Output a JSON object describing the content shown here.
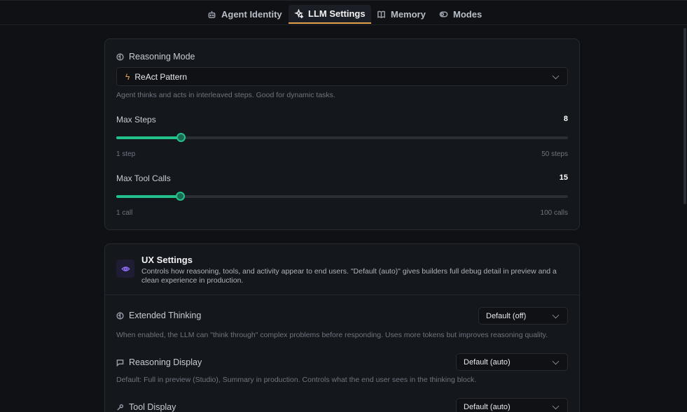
{
  "tabs": [
    {
      "label": "Agent Identity",
      "icon": "robot-icon",
      "active": false
    },
    {
      "label": "LLM Settings",
      "icon": "sparkles-icon",
      "active": true
    },
    {
      "label": "Memory",
      "icon": "book-icon",
      "active": false
    },
    {
      "label": "Modes",
      "icon": "toggle-icon",
      "active": false
    }
  ],
  "reasoning": {
    "label": "Reasoning Mode",
    "selected": "ReAct Pattern",
    "helper": "Agent thinks and acts in interleaved steps. Good for dynamic tasks."
  },
  "max_steps": {
    "label": "Max Steps",
    "value": "8",
    "min_label": "1 step",
    "max_label": "50 steps",
    "fraction": 0.1429
  },
  "max_tool_calls": {
    "label": "Max Tool Calls",
    "value": "15",
    "min_label": "1 call",
    "max_label": "100 calls",
    "fraction": 0.1414
  },
  "ux": {
    "title": "UX Settings",
    "description": "Controls how reasoning, tools, and activity appear to end users. \"Default (auto)\" gives builders full debug detail in preview and a clean experience in production.",
    "extended_thinking": {
      "label": "Extended Thinking",
      "selected": "Default (off)",
      "helper": "When enabled, the LLM can \"think through\" complex problems before responding. Uses more tokens but improves reasoning quality."
    },
    "reasoning_display": {
      "label": "Reasoning Display",
      "selected": "Default (auto)",
      "helper": "Default: Full in preview (Studio), Summary in production. Controls what the end user sees in the thinking block."
    },
    "tool_display": {
      "label": "Tool Display",
      "selected": "Default (auto)"
    }
  },
  "colors": {
    "accent": "#22c08a",
    "tab_active_underline": "#e0a24a",
    "ux_icon": "#8b6cf0",
    "lightning": "#e0a24a"
  }
}
